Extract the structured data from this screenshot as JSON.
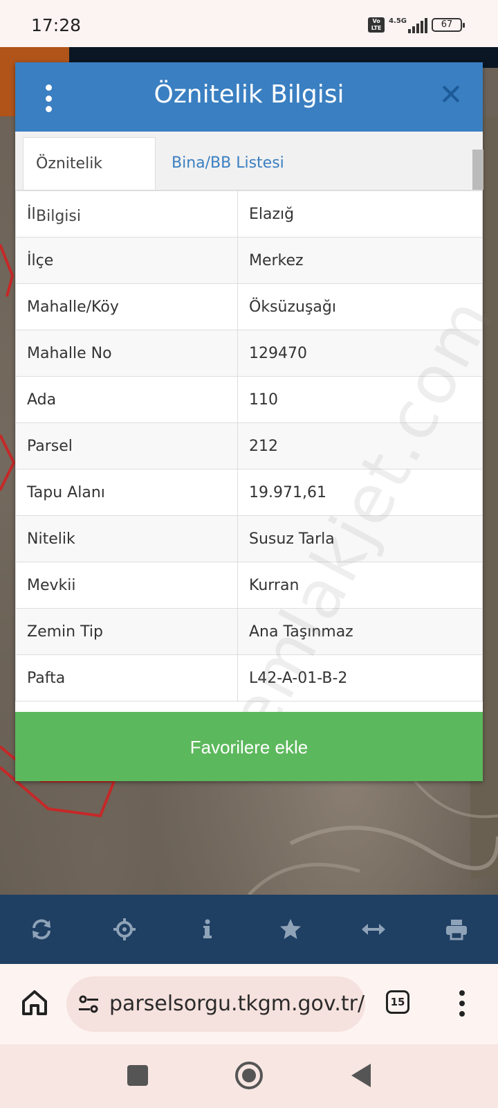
{
  "status_bar": {
    "time": "17:28",
    "network": "4.5G",
    "volte": "Vo LTE",
    "battery": "67"
  },
  "modal": {
    "title": "Öznitelik Bilgisi",
    "tabs": [
      {
        "label": "Öznitelik Bilgisi"
      },
      {
        "label": "Bina/BB Listesi"
      }
    ],
    "rows": [
      {
        "key": "İl",
        "value": "Elazığ"
      },
      {
        "key": "İlçe",
        "value": "Merkez"
      },
      {
        "key": "Mahalle/Köy",
        "value": "Öksüzuşağı"
      },
      {
        "key": "Mahalle No",
        "value": "129470"
      },
      {
        "key": "Ada",
        "value": "110"
      },
      {
        "key": "Parsel",
        "value": "212"
      },
      {
        "key": "Tapu Alanı",
        "value": "19.971,61"
      },
      {
        "key": "Nitelik",
        "value": "Susuz Tarla"
      },
      {
        "key": "Mevkii",
        "value": "Kurran"
      },
      {
        "key": "Zemin Tip",
        "value": "Ana Taşınmaz"
      },
      {
        "key": "Pafta",
        "value": "L42-A-01-B-2"
      }
    ],
    "favorite_button": "Favorilere ekle",
    "watermark": "emlakjet.com"
  },
  "toolbar": {
    "icons": [
      "refresh-icon",
      "crosshair-icon",
      "info-icon",
      "star-icon",
      "arrows-horizontal-icon",
      "print-icon"
    ]
  },
  "browser": {
    "url": "parselsorgu.tkgm.gov.tr/",
    "tab_count": "15"
  },
  "colors": {
    "header_blue": "#3a7fc1",
    "close_blue": "#1c5a99",
    "button_green": "#5cb85c",
    "toolbar_navy": "#1f3f63"
  }
}
